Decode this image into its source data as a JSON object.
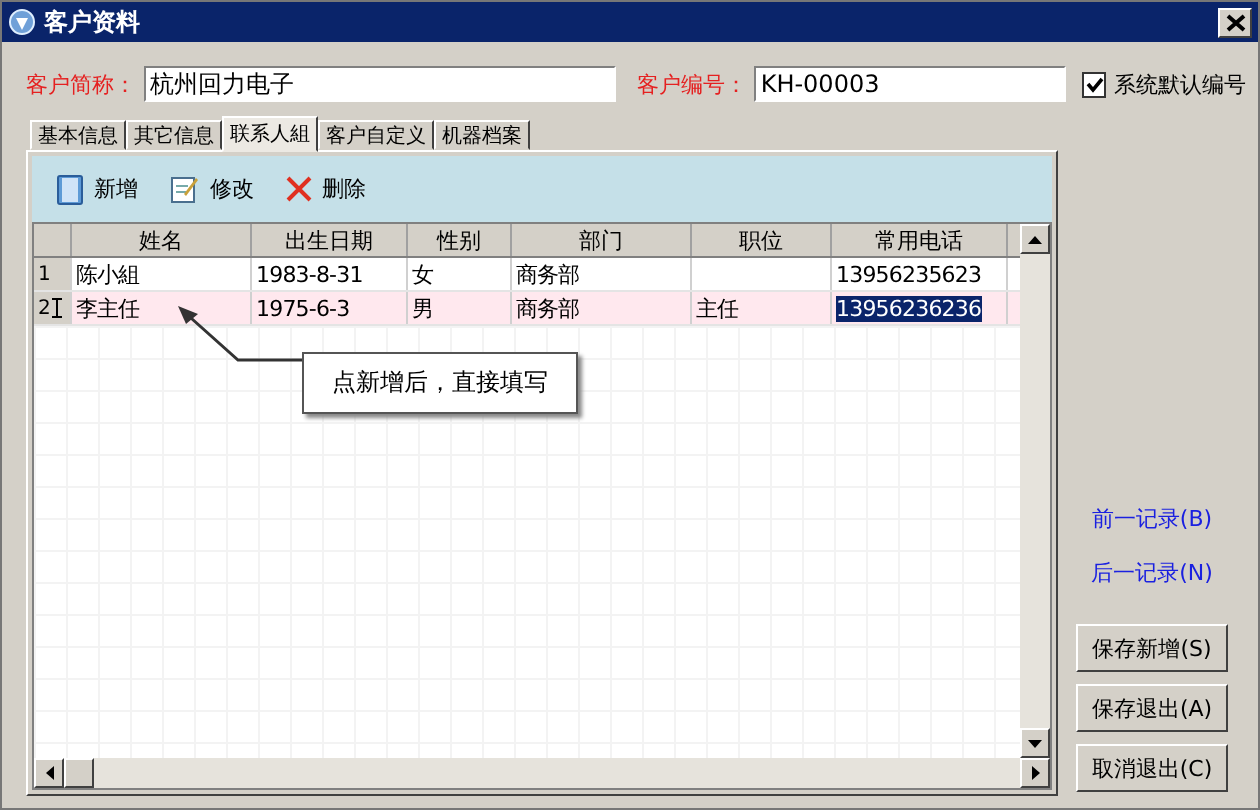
{
  "window": {
    "title": "客户资料"
  },
  "form": {
    "name_label": "客户简称：",
    "name_value": "杭州回力电子",
    "code_label": "客户编号：",
    "code_value": "KH-00003",
    "auto_code": {
      "label": "系统默认编号",
      "checked": true
    }
  },
  "tabs": [
    {
      "label": "基本信息",
      "selected": false
    },
    {
      "label": "其它信息",
      "selected": false
    },
    {
      "label": "联系人組",
      "selected": true
    },
    {
      "label": "客户自定义",
      "selected": false
    },
    {
      "label": "机器档案",
      "selected": false
    }
  ],
  "toolbar": [
    {
      "kind": "new",
      "label": "新增"
    },
    {
      "kind": "edit",
      "label": "修改"
    },
    {
      "kind": "delete",
      "label": "删除"
    }
  ],
  "table": {
    "columns": [
      "姓名",
      "出生日期",
      "性别",
      "部门",
      "职位",
      "常用电话"
    ],
    "rows": [
      {
        "index": "1",
        "selected": false,
        "cells": {
          "name": "陈小組",
          "birth": "1983-8-31",
          "gender": "女",
          "dept": "商务部",
          "phone": "13956235623"
        }
      },
      {
        "index": "2",
        "selected": true,
        "cells": {
          "name": "李主任",
          "birth": "1975-6-3",
          "gender": "男",
          "dept": "商务部",
          "position": "主任",
          "phone": "13956236236"
        }
      }
    ]
  },
  "callout": {
    "text": "点新增后，直接填写"
  },
  "nav_links": [
    "前一记录(B)",
    "后一记录(N)"
  ],
  "buttons": [
    "保存新增(S)",
    "保存退出(A)",
    "取消退出(C)"
  ]
}
